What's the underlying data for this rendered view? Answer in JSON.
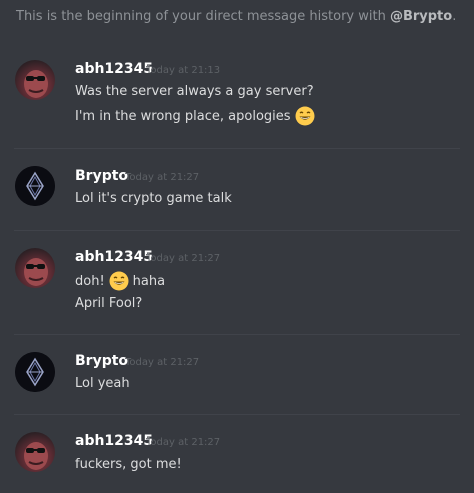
{
  "header": {
    "prefix": "This is the beginning of your direct message history with ",
    "user": "@Brypto",
    "suffix": "."
  },
  "messages": [
    {
      "author": "abh12345",
      "timestamp": "Today at 21:13",
      "lines": [
        "Was the server always a gay server?",
        "I'm in the wrong place, apologies"
      ]
    },
    {
      "author": "Brypto",
      "timestamp": "Today at 21:27",
      "lines": [
        "Lol it's crypto game talk"
      ]
    },
    {
      "author": "abh12345",
      "timestamp": "Today at 21:27",
      "lines": [
        "doh!",
        "haha",
        "April Fool?"
      ]
    },
    {
      "author": "Brypto",
      "timestamp": "Today at 21:27",
      "lines": [
        "Lol yeah"
      ]
    },
    {
      "author": "abh12345",
      "timestamp": "Today at 21:27",
      "lines": [
        "fuckers, got me!"
      ]
    }
  ],
  "icons": {
    "emoji": "grinning-face-emoji",
    "avatar_abh": "user-avatar-photo",
    "avatar_brypto": "ethereum-logo-avatar"
  },
  "colors": {
    "background": "#36393f",
    "username": "#ffffff",
    "timestamp": "#5d6166",
    "text": "#dcddde",
    "divider": "#40434a"
  }
}
